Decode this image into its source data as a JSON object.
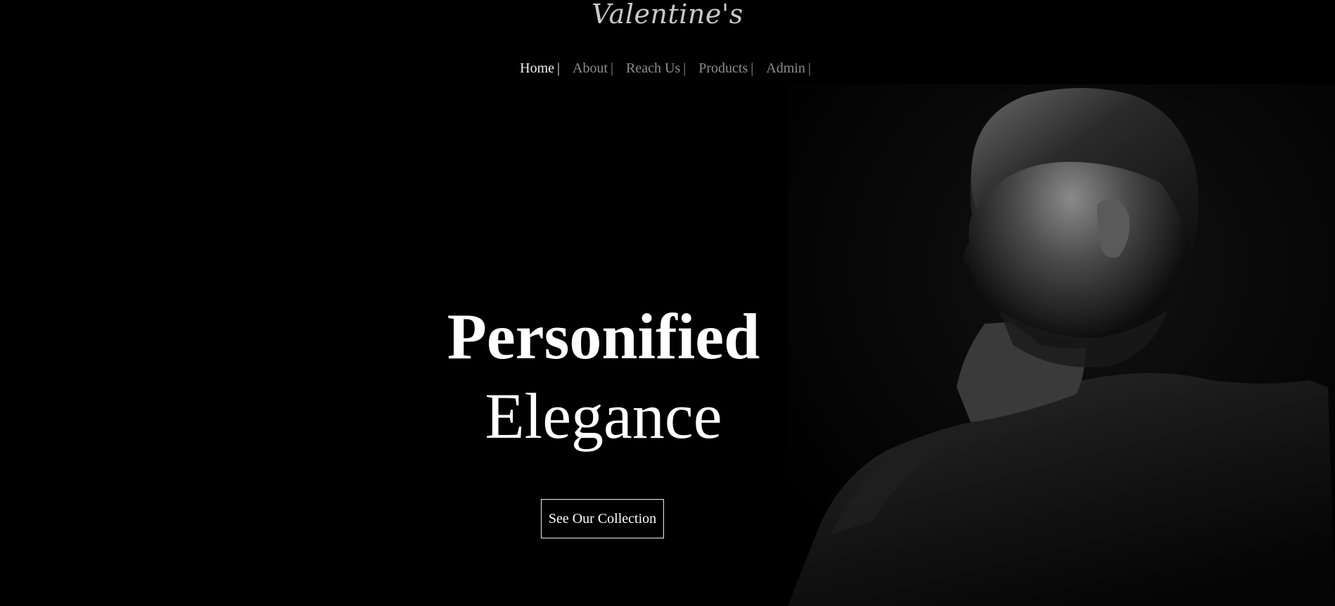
{
  "brand": {
    "name": "Valentine's"
  },
  "nav": {
    "items": [
      {
        "label": "Home",
        "separator": "|",
        "active": true
      },
      {
        "label": "About",
        "separator": "|",
        "active": false
      },
      {
        "label": "Reach Us",
        "separator": "|",
        "active": false
      },
      {
        "label": "Products",
        "separator": "|",
        "active": false
      },
      {
        "label": "Admin",
        "separator": "|",
        "active": false
      }
    ]
  },
  "hero": {
    "line1": "Personified",
    "line2": "Elegance",
    "cta_label": "See Our Collection"
  },
  "colors": {
    "background": "#000000",
    "text": "#ffffff",
    "nav_inactive": "#8d8d8d",
    "brand": "#c8c8c8"
  }
}
